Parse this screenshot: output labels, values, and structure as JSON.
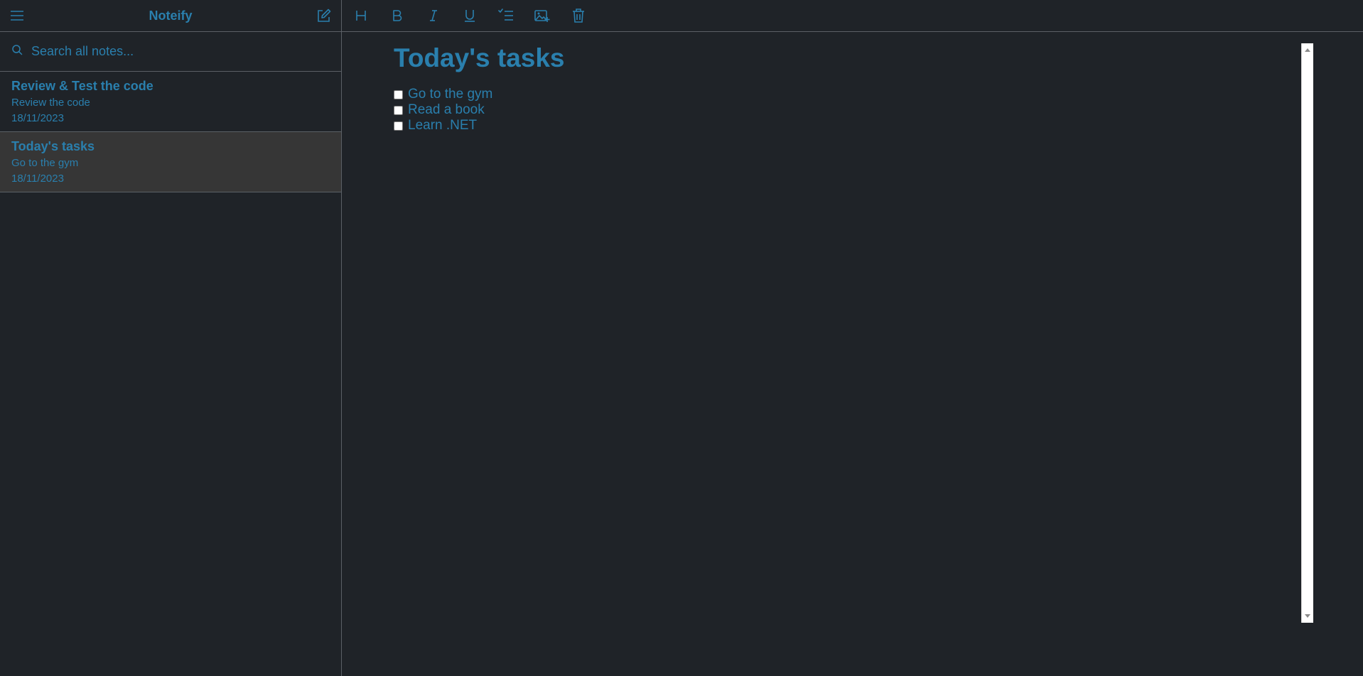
{
  "app": {
    "title": "Noteify"
  },
  "icons": {
    "menu": "hamburger-menu-icon",
    "new_note": "new-note-icon",
    "search": "search-icon",
    "heading": "heading-icon",
    "bold": "bold-icon",
    "italic": "italic-icon",
    "underline": "underline-icon",
    "checklist": "checklist-icon",
    "add_image": "add-image-icon",
    "delete": "trash-icon"
  },
  "search": {
    "placeholder": "Search all notes..."
  },
  "notes": [
    {
      "title": "Review & Test the code",
      "preview": "Review the code",
      "date": "18/11/2023"
    },
    {
      "title": "Today's tasks",
      "preview": "Go to the gym",
      "date": "18/11/2023"
    }
  ],
  "editor": {
    "title": "Today's tasks",
    "tasks": [
      {
        "label": "Go to the gym"
      },
      {
        "label": "Read a book"
      },
      {
        "label": "Learn .NET"
      }
    ]
  },
  "colors": {
    "accent": "#2a7fad",
    "background": "#1f2328",
    "active_note": "#363636",
    "divider": "#5b6066"
  }
}
